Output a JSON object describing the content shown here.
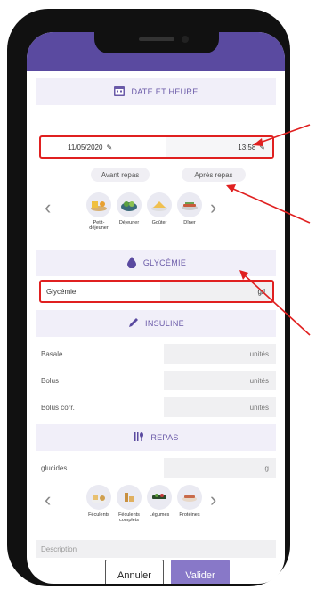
{
  "header": {
    "date_section": "DATE ET HEURE"
  },
  "datetime": {
    "date": "11/05/2020",
    "time": "13:58"
  },
  "meal_timing": {
    "before": "Avant repas",
    "after": "Après repas"
  },
  "meals": [
    {
      "label": "Petit-\ndéjeuner",
      "icon": "breakfast-icon"
    },
    {
      "label": "Déjeuner",
      "icon": "lunch-icon"
    },
    {
      "label": "Goûter",
      "icon": "snack-icon"
    },
    {
      "label": "Dîner",
      "icon": "dinner-icon"
    }
  ],
  "glycemie": {
    "section": "GLYCÉMIE",
    "label": "Glycémie",
    "unit": "g/l"
  },
  "insuline": {
    "section": "INSULINE",
    "rows": [
      {
        "label": "Basale",
        "unit": "unités"
      },
      {
        "label": "Bolus",
        "unit": "unités"
      },
      {
        "label": "Bolus corr.",
        "unit": "unités"
      }
    ]
  },
  "repas": {
    "section": "REPAS",
    "glucides_label": "glucides",
    "glucides_unit": "g",
    "foods": [
      {
        "label": "Féculents",
        "icon": "starch-icon"
      },
      {
        "label": "Féculents\ncomplets",
        "icon": "wholegrain-icon"
      },
      {
        "label": "Légumes",
        "icon": "vegetables-icon"
      },
      {
        "label": "Protéines",
        "icon": "proteins-icon"
      }
    ],
    "description_placeholder": "Description"
  },
  "actions": {
    "cancel": "Annuler",
    "validate": "Valider"
  },
  "colors": {
    "accent": "#5a4aa0",
    "highlight": "#e02020",
    "button": "#8878c8"
  }
}
